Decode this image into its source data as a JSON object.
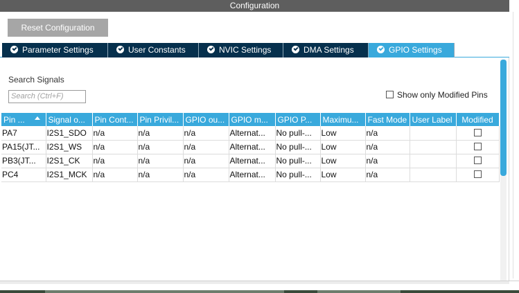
{
  "window": {
    "title": "Configuration"
  },
  "toolbar": {
    "reset_label": "Reset Configuration"
  },
  "tabs": [
    {
      "label": "Parameter Settings",
      "active": false
    },
    {
      "label": "User Constants",
      "active": false
    },
    {
      "label": "NVIC Settings",
      "active": false
    },
    {
      "label": "DMA Settings",
      "active": false
    },
    {
      "label": "GPIO Settings",
      "active": true
    }
  ],
  "search": {
    "label": "Search Signals",
    "placeholder": "Search (Ctrl+F)",
    "value": ""
  },
  "filter": {
    "show_only_modified_label": "Show only Modified Pins",
    "checked": false
  },
  "table": {
    "columns": [
      "Pin ...",
      "Signal o...",
      "Pin Cont...",
      "Pin Privil...",
      "GPIO ou...",
      "GPIO m...",
      "GPIO P...",
      "Maximu...",
      "Fast Mode",
      "User Label",
      "Modified"
    ],
    "rows": [
      {
        "pin": "PA7",
        "signal": "I2S1_SDO",
        "context": "n/a",
        "privilege": "n/a",
        "output": "n/a",
        "mode": "Alternat...",
        "pull": "No pull-...",
        "speed": "Low",
        "fast_mode": "n/a",
        "user_label": "",
        "modified": false
      },
      {
        "pin": "PA15(JT...",
        "signal": "I2S1_WS",
        "context": "n/a",
        "privilege": "n/a",
        "output": "n/a",
        "mode": "Alternat...",
        "pull": "No pull-...",
        "speed": "Low",
        "fast_mode": "n/a",
        "user_label": "",
        "modified": false
      },
      {
        "pin": "PB3(JT...",
        "signal": "I2S1_CK",
        "context": "n/a",
        "privilege": "n/a",
        "output": "n/a",
        "mode": "Alternat...",
        "pull": "No pull-...",
        "speed": "Low",
        "fast_mode": "n/a",
        "user_label": "",
        "modified": false
      },
      {
        "pin": "PC4",
        "signal": "I2S1_MCK",
        "context": "n/a",
        "privilege": "n/a",
        "output": "n/a",
        "mode": "Alternat...",
        "pull": "No pull-...",
        "speed": "Low",
        "fast_mode": "n/a",
        "user_label": "",
        "modified": false
      }
    ]
  },
  "colors": {
    "accent": "#39a9dc",
    "tab_dark": "#06304d",
    "title_bar": "#5e5e5e",
    "button_gray": "#a6a6a6"
  },
  "icons": {
    "tab_status": "check-circle-icon",
    "sort": "sort-ascending-icon"
  }
}
